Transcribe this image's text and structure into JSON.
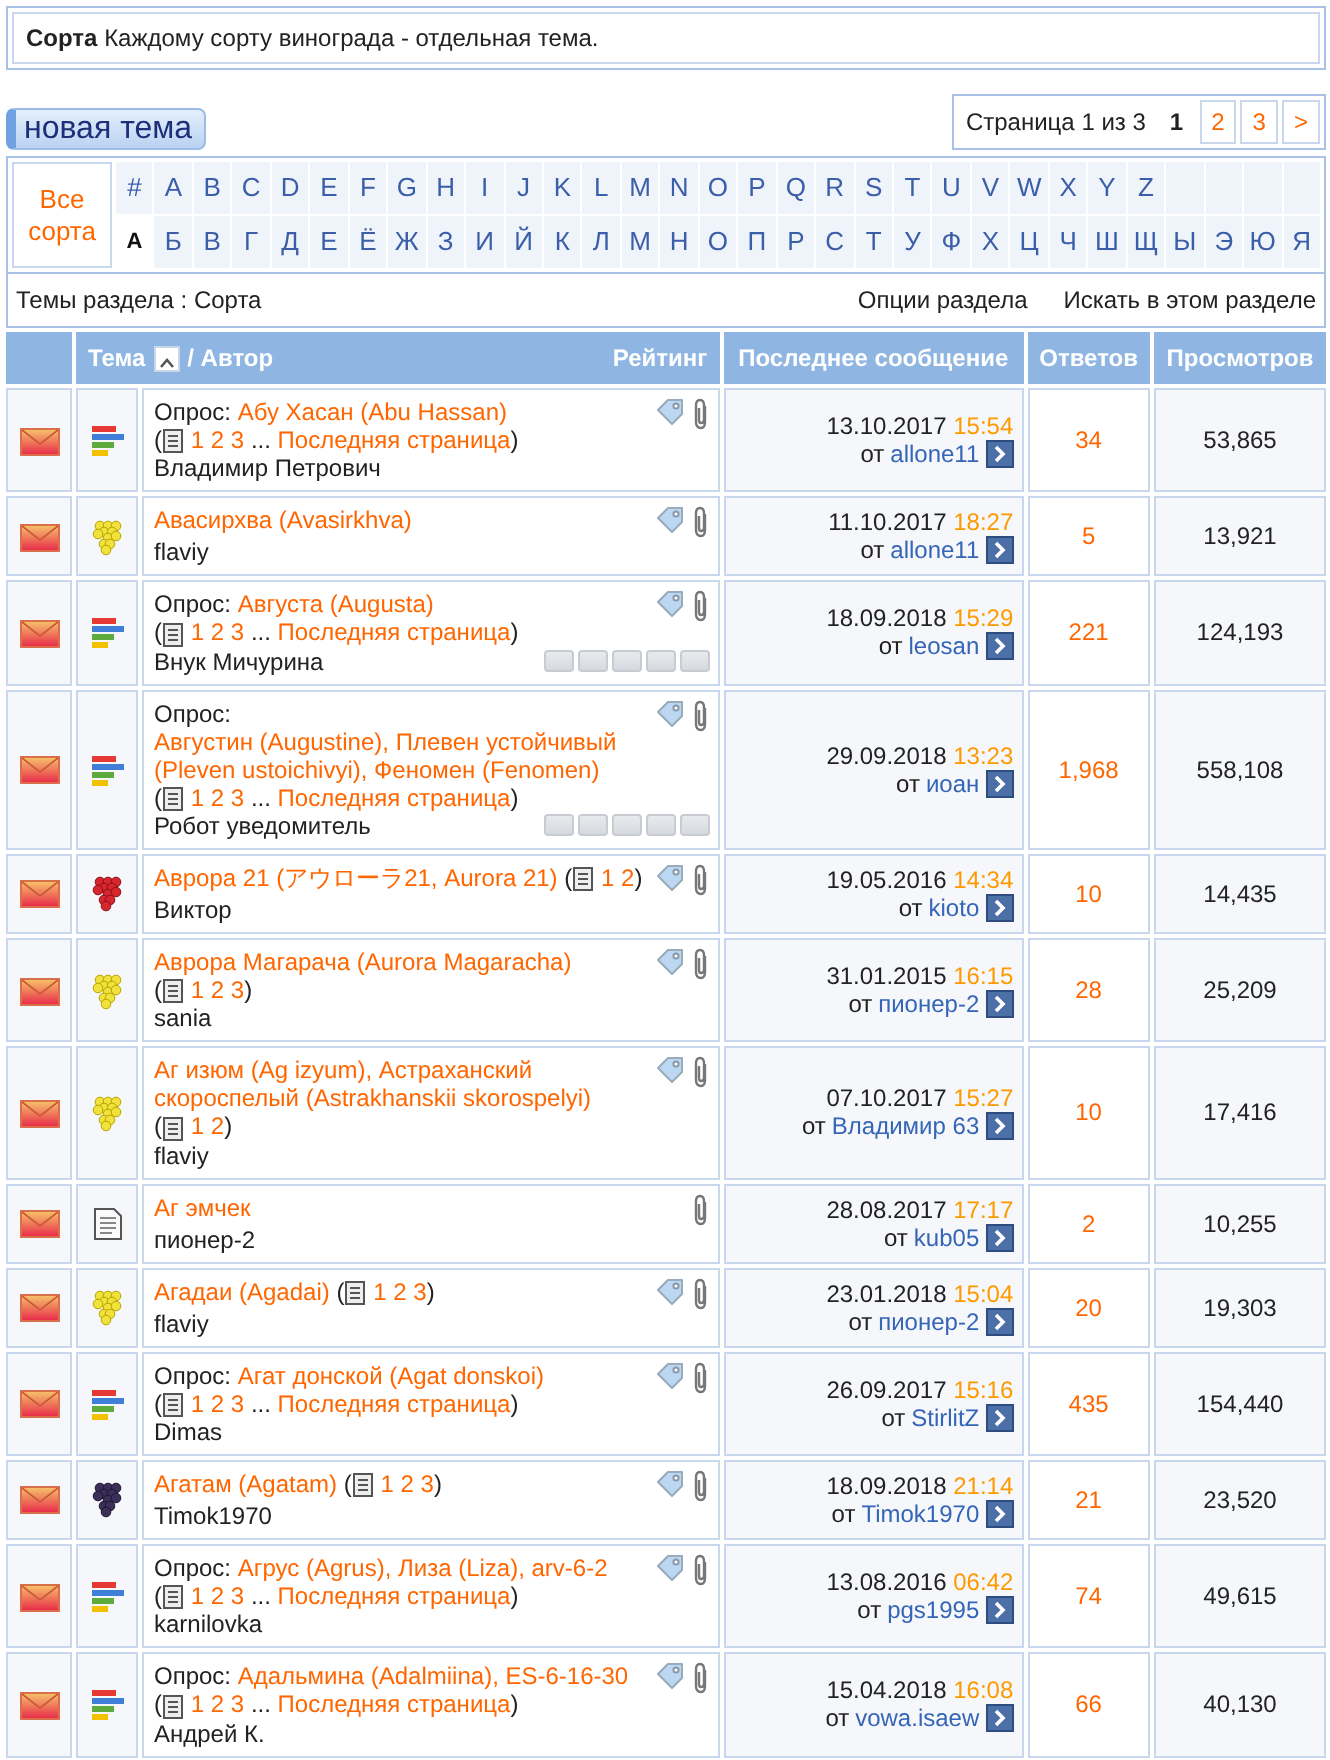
{
  "forum": {
    "title": "Сорта",
    "description": "Каждому сорту винограда - отдельная тема."
  },
  "new_topic_button": "новая тема",
  "pagination": {
    "label": "Страница 1 из 3",
    "pages": [
      {
        "label": "1",
        "selected": true
      },
      {
        "label": "2",
        "selected": false
      },
      {
        "label": "3",
        "selected": false
      }
    ],
    "next": ">"
  },
  "alphabet": {
    "all": "Все сорта",
    "latin": [
      {
        "label": "#",
        "selected": false
      },
      {
        "label": "A",
        "selected": false
      },
      {
        "label": "B",
        "selected": false
      },
      {
        "label": "C",
        "selected": false
      },
      {
        "label": "D",
        "selected": false
      },
      {
        "label": "E",
        "selected": false
      },
      {
        "label": "F",
        "selected": false
      },
      {
        "label": "G",
        "selected": false
      },
      {
        "label": "H",
        "selected": false
      },
      {
        "label": "I",
        "selected": false
      },
      {
        "label": "J",
        "selected": false
      },
      {
        "label": "K",
        "selected": false
      },
      {
        "label": "L",
        "selected": false
      },
      {
        "label": "M",
        "selected": false
      },
      {
        "label": "N",
        "selected": false
      },
      {
        "label": "O",
        "selected": false
      },
      {
        "label": "P",
        "selected": false
      },
      {
        "label": "Q",
        "selected": false
      },
      {
        "label": "R",
        "selected": false
      },
      {
        "label": "S",
        "selected": false
      },
      {
        "label": "T",
        "selected": false
      },
      {
        "label": "U",
        "selected": false
      },
      {
        "label": "V",
        "selected": false
      },
      {
        "label": "W",
        "selected": false
      },
      {
        "label": "X",
        "selected": false
      },
      {
        "label": "Y",
        "selected": false
      },
      {
        "label": "Z",
        "selected": false
      }
    ],
    "cyrillic": [
      {
        "label": "А",
        "selected": true
      },
      {
        "label": "Б",
        "selected": false
      },
      {
        "label": "В",
        "selected": false
      },
      {
        "label": "Г",
        "selected": false
      },
      {
        "label": "Д",
        "selected": false
      },
      {
        "label": "Е",
        "selected": false
      },
      {
        "label": "Ё",
        "selected": false
      },
      {
        "label": "Ж",
        "selected": false
      },
      {
        "label": "З",
        "selected": false
      },
      {
        "label": "И",
        "selected": false
      },
      {
        "label": "Й",
        "selected": false
      },
      {
        "label": "К",
        "selected": false
      },
      {
        "label": "Л",
        "selected": false
      },
      {
        "label": "М",
        "selected": false
      },
      {
        "label": "Н",
        "selected": false
      },
      {
        "label": "О",
        "selected": false
      },
      {
        "label": "П",
        "selected": false
      },
      {
        "label": "Р",
        "selected": false
      },
      {
        "label": "С",
        "selected": false
      },
      {
        "label": "Т",
        "selected": false
      },
      {
        "label": "У",
        "selected": false
      },
      {
        "label": "Ф",
        "selected": false
      },
      {
        "label": "Х",
        "selected": false
      },
      {
        "label": "Ц",
        "selected": false
      },
      {
        "label": "Ч",
        "selected": false
      },
      {
        "label": "Ш",
        "selected": false
      },
      {
        "label": "Щ",
        "selected": false
      },
      {
        "label": "Ы",
        "selected": false
      },
      {
        "label": "Э",
        "selected": false
      },
      {
        "label": "Ю",
        "selected": false
      },
      {
        "label": "Я",
        "selected": false
      }
    ]
  },
  "section_bar": {
    "title": "Темы раздела : Сорта",
    "links": [
      "Опции раздела",
      "Искать в этом разделе"
    ]
  },
  "columns": {
    "topic": "Тема",
    "author": "/ Автор",
    "rating": "Рейтинг",
    "last_post": "Последнее сообщение",
    "replies": "Ответов",
    "views": "Просмотров"
  },
  "rows": [
    {
      "kind": "poll",
      "prefix": "Опрос:",
      "title": "Абу Хасан (Abu Hassan)",
      "pager": {
        "open": "(",
        "pages": [
          "1",
          "2",
          "3"
        ],
        "ellipsis": "...",
        "last": "Последняя страница",
        "close": ")"
      },
      "author": "Владимир Петрович",
      "tagged": true,
      "attachment": true,
      "date": "13.10.2017",
      "time": "15:54",
      "by": "от",
      "user": "allone11",
      "replies": "34",
      "views": "53,865"
    },
    {
      "kind": "grapes",
      "title": "Авасирхва (Avasirkhva)",
      "author": "flaviy",
      "tagged": true,
      "attachment": true,
      "date": "11.10.2017",
      "time": "18:27",
      "by": "от",
      "user": "allone11",
      "replies": "5",
      "views": "13,921"
    },
    {
      "kind": "poll",
      "prefix": "Опрос:",
      "title": "Августа (Augusta)",
      "pager": {
        "open": "(",
        "pages": [
          "1",
          "2",
          "3"
        ],
        "ellipsis": "...",
        "last": "Последняя страница",
        "close": ")"
      },
      "author": "Внук Мичурина",
      "stars": 0,
      "tagged": true,
      "attachment": true,
      "date": "18.09.2018",
      "time": "15:29",
      "by": "от",
      "user": "leosan",
      "replies": "221",
      "views": "124,193"
    },
    {
      "kind": "poll",
      "prefix": "Опрос:",
      "title": "Августин (Augustine), Плевен устойчивый (Pleven ustoichivyi), Феномен (Fenomen)",
      "pager": {
        "open": "(",
        "pages": [
          "1",
          "2",
          "3"
        ],
        "ellipsis": "...",
        "last": "Последняя страница",
        "close": ")"
      },
      "author": "Робот уведомитель",
      "stars": 0,
      "tagged": true,
      "attachment": true,
      "date": "29.09.2018",
      "time": "13:23",
      "by": "от",
      "user": "иоан",
      "replies": "1,968",
      "views": "558,108"
    },
    {
      "kind": "raspberry",
      "title": "Аврора 21 (アウローラ21, Aurora 21)",
      "pager": {
        "open": "(",
        "pages": [
          "1",
          "2"
        ],
        "close": ")"
      },
      "author": "Виктор",
      "tagged": true,
      "attachment": true,
      "date": "19.05.2016",
      "time": "14:34",
      "by": "от",
      "user": "kioto",
      "replies": "10",
      "views": "14,435"
    },
    {
      "kind": "grapes",
      "title": "Аврора Магарача (Aurora Magaracha)",
      "pager": {
        "open": "(",
        "pages": [
          "1",
          "2",
          "3"
        ],
        "close": ")"
      },
      "author": "sania",
      "tagged": true,
      "attachment": true,
      "date": "31.01.2015",
      "time": "16:15",
      "by": "от",
      "user": "пионер-2",
      "replies": "28",
      "views": "25,209"
    },
    {
      "kind": "grapes",
      "title": "Аг изюм (Ag izyum), Астраханский скороспелый (Astrakhanskii skorospelyi)",
      "pager": {
        "open": "(",
        "pages": [
          "1",
          "2"
        ],
        "close": ")"
      },
      "author": "flaviy",
      "tagged": true,
      "attachment": true,
      "date": "07.10.2017",
      "time": "15:27",
      "by": "от",
      "user": "Владимир 63",
      "replies": "10",
      "views": "17,416"
    },
    {
      "kind": "document",
      "title": "Аг эмчек",
      "author": "пионер-2",
      "tagged": false,
      "attachment": true,
      "date": "28.08.2017",
      "time": "17:17",
      "by": "от",
      "user": "kub05",
      "replies": "2",
      "views": "10,255"
    },
    {
      "kind": "grapes",
      "title": "Агадаи (Agadai)",
      "pager": {
        "open": "(",
        "pages": [
          "1",
          "2",
          "3"
        ],
        "close": ")"
      },
      "author": "flaviy",
      "tagged": true,
      "attachment": true,
      "date": "23.01.2018",
      "time": "15:04",
      "by": "от",
      "user": "пионер-2",
      "replies": "20",
      "views": "19,303"
    },
    {
      "kind": "poll",
      "prefix": "Опрос:",
      "title": "Агат донской (Agat donskoi)",
      "pager": {
        "open": "(",
        "pages": [
          "1",
          "2",
          "3"
        ],
        "ellipsis": "...",
        "last": "Последняя страница",
        "close": ")"
      },
      "author": "Dimas",
      "tagged": true,
      "attachment": true,
      "date": "26.09.2017",
      "time": "15:16",
      "by": "от",
      "user": "StirlitZ",
      "replies": "435",
      "views": "154,440"
    },
    {
      "kind": "dark_grapes",
      "title": "Агатам (Agatam)",
      "pager": {
        "open": "(",
        "pages": [
          "1",
          "2",
          "3"
        ],
        "close": ")"
      },
      "author": "Timok1970",
      "tagged": true,
      "attachment": true,
      "date": "18.09.2018",
      "time": "21:14",
      "by": "от",
      "user": "Timok1970",
      "replies": "21",
      "views": "23,520"
    },
    {
      "kind": "poll",
      "prefix": "Опрос:",
      "title": "Агрус (Agrus), Лиза (Liza), arv-6-2",
      "pager": {
        "open": "(",
        "pages": [
          "1",
          "2",
          "3"
        ],
        "ellipsis": "...",
        "last": "Последняя страница",
        "close": ")"
      },
      "author": "karnilovka",
      "tagged": true,
      "attachment": true,
      "date": "13.08.2016",
      "time": "06:42",
      "by": "от",
      "user": "pgs1995",
      "replies": "74",
      "views": "49,615"
    },
    {
      "kind": "poll",
      "prefix": "Опрос:",
      "title": "Адальмина (Adalmiina), ES-6-16-30",
      "pager": {
        "open": "(",
        "pages": [
          "1",
          "2",
          "3"
        ],
        "ellipsis": "...",
        "last": "Последняя страница",
        "close": ")"
      },
      "author": "Андрей К.",
      "tagged": true,
      "attachment": true,
      "date": "15.04.2018",
      "time": "16:08",
      "by": "от",
      "user": "vowa.isaew",
      "replies": "66",
      "views": "40,130"
    }
  ]
}
